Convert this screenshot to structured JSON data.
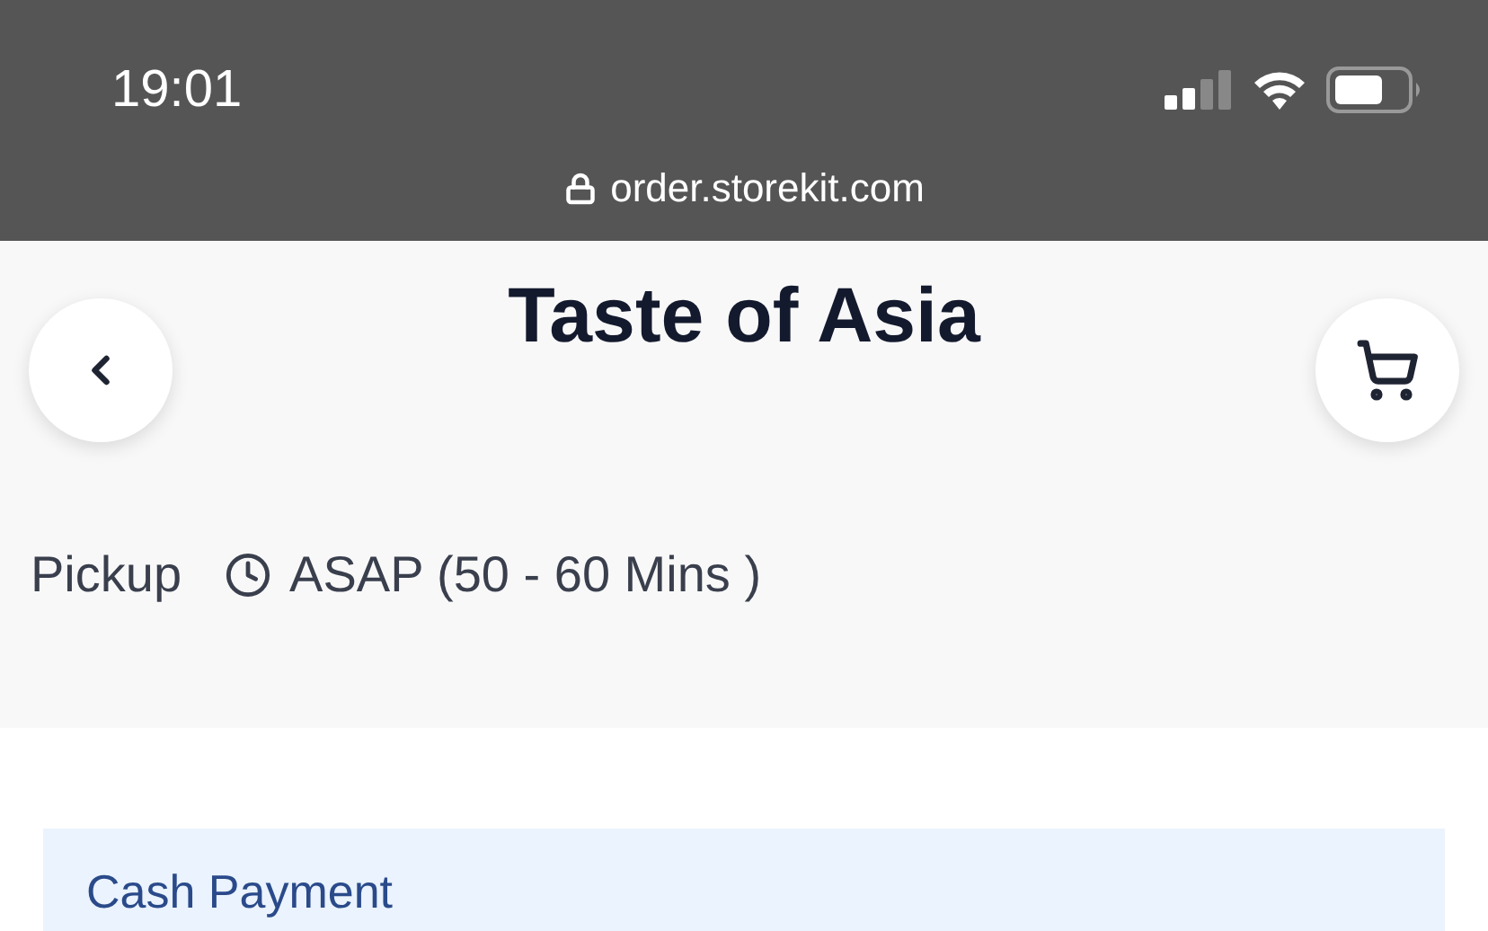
{
  "status_bar": {
    "time": "19:01",
    "url": "order.storekit.com"
  },
  "header": {
    "title": "Taste of Asia"
  },
  "order_info": {
    "mode": "Pickup",
    "time": "ASAP (50 - 60 Mins )"
  },
  "payment_card": {
    "title": "Cash Payment"
  }
}
